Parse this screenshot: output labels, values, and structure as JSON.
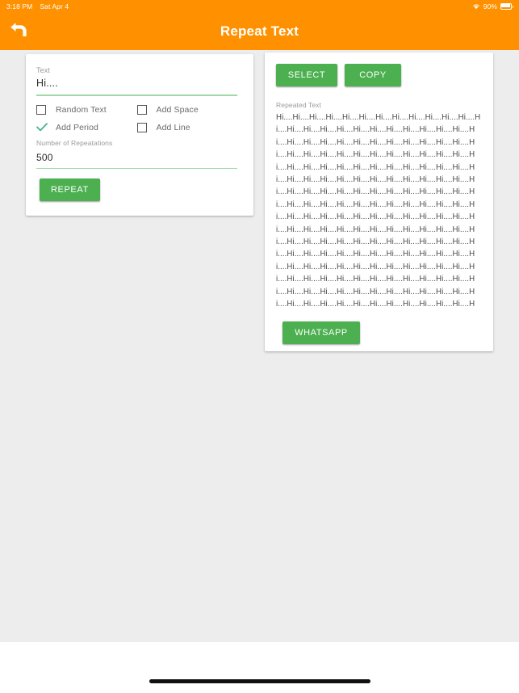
{
  "status_bar": {
    "time": "3:18 PM",
    "date": "Sat Apr 4",
    "battery_percent": "90%",
    "wifi_icon": "wifi-icon",
    "battery_icon": "battery-icon"
  },
  "app_bar": {
    "title": "Repeat Text",
    "back_icon": "back-arrow-icon",
    "background_color": "#FF9100"
  },
  "theme": {
    "accent_green": "#4CAF50",
    "header_orange": "#FF9100",
    "underline_green": "#9ED9A6",
    "page_background": "#EDEDED"
  },
  "input_card": {
    "text_field": {
      "label": "Text",
      "value": "Hi....",
      "placeholder": "Text"
    },
    "checkboxes": [
      {
        "label": "Random Text",
        "checked": false
      },
      {
        "label": "Add Space",
        "checked": false
      },
      {
        "label": "Add Period",
        "checked": true
      },
      {
        "label": "Add Line",
        "checked": false
      }
    ],
    "repetitions_field": {
      "label": "Number of Repeatations",
      "value": "500",
      "placeholder": "Number of Repeatations"
    },
    "repeat_button_label": "REPEAT"
  },
  "output_card": {
    "select_button_label": "SELECT",
    "copy_button_label": "COPY",
    "repeated_text_label": "Repeated Text",
    "repeated_text_unit": "Hi....",
    "repeated_text_value": "Hi....Hi....Hi....Hi....Hi....Hi....Hi....Hi....Hi....Hi....Hi....Hi....Hi....Hi....Hi....Hi....Hi....Hi....Hi....Hi....Hi....Hi....Hi....Hi....Hi....Hi....Hi....Hi....Hi....Hi....Hi....Hi....Hi....Hi....Hi....Hi....Hi....Hi....Hi....Hi....Hi....Hi....Hi....Hi....Hi....Hi....Hi....Hi....Hi....Hi....Hi....Hi....Hi....Hi....Hi....Hi....Hi....Hi....Hi....Hi....Hi....Hi....Hi....Hi....Hi....Hi....Hi....Hi....Hi....Hi....Hi....Hi....Hi....Hi....Hi....Hi....Hi....Hi....Hi....Hi....Hi....Hi....Hi....Hi....Hi....Hi....Hi....Hi....Hi....Hi....Hi....Hi....Hi....Hi....Hi....Hi....Hi....Hi....Hi....Hi....Hi....Hi....Hi....Hi....Hi....Hi....Hi....Hi....Hi....Hi....Hi....Hi....Hi....Hi....Hi....Hi....Hi....Hi....Hi....Hi....Hi....Hi....Hi....Hi....Hi....Hi....Hi....Hi....Hi....Hi....Hi....Hi....Hi....Hi....Hi....Hi....Hi....Hi....Hi....Hi....Hi....Hi....Hi....Hi....Hi....Hi....Hi....Hi....Hi....Hi....Hi....Hi....Hi....Hi....Hi....Hi....Hi....Hi....Hi....Hi....Hi....Hi....Hi....Hi....Hi....Hi....Hi....Hi....Hi....Hi....Hi....Hi....Hi....Hi....Hi....Hi....Hi....Hi....Hi....Hi....Hi....Hi....Hi....Hi....Hi....Hi....Hi....Hi....Hi....Hi....Hi....Hi....Hi....Hi....Hi....Hi....Hi....Hi....Hi....Hi....Hi....Hi....Hi....Hi....Hi....Hi....Hi....Hi....Hi....Hi....Hi....Hi....Hi....Hi....Hi....Hi....Hi....Hi....Hi....Hi....Hi....Hi....Hi....Hi....Hi....Hi....Hi....Hi....Hi....Hi....Hi....Hi....Hi....Hi....Hi....Hi....Hi....Hi....Hi....Hi....Hi....Hi....Hi....Hi....Hi....Hi....Hi....Hi....Hi....Hi....Hi....Hi....Hi....Hi....Hi....Hi....Hi....Hi....Hi....Hi....Hi....Hi....Hi....Hi....",
    "whatsapp_button_label": "WHATSAPP"
  },
  "system": {
    "home_indicator": "home-indicator"
  }
}
